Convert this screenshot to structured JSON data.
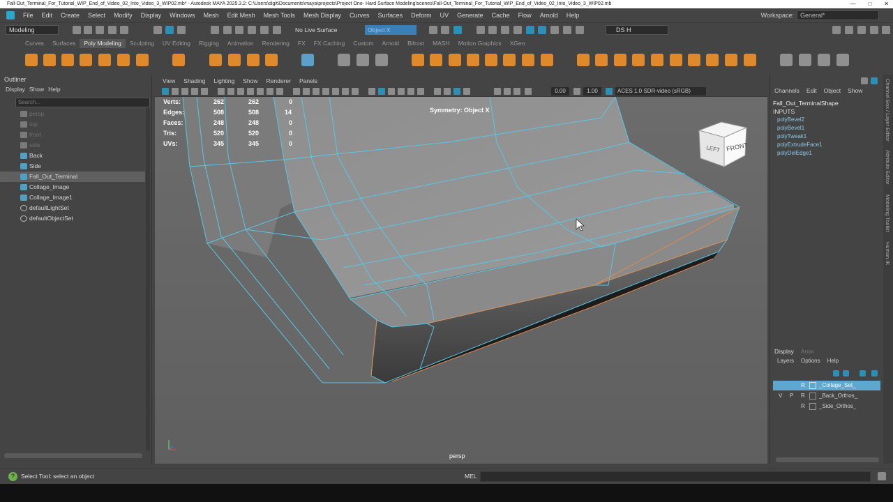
{
  "window": {
    "title": "Fall-Out_Terminal_For_Tutorial_WIP_End_of_Video_02_Into_Video_3_WIP02.mb* - Autodesk MAYA 2025.3.2: C:\\Users\\digit\\Documents\\maya\\projects\\Project One- Hard Surface Modeling\\scenes\\Fall-Out_Terminal_For_Tutorial_WIP_End_of_Video_02_Into_Video_3_WIP02.mb",
    "controls": [
      "—",
      "□",
      "✕"
    ]
  },
  "menubar": {
    "items": [
      "File",
      "Edit",
      "Create",
      "Select",
      "Modify",
      "Display",
      "Windows",
      "Mesh",
      "Edit Mesh",
      "Mesh Tools",
      "Mesh Display",
      "Curves",
      "Surfaces",
      "Deform",
      "UV",
      "Generate",
      "Cache",
      "Flow",
      "Arnold",
      "Help"
    ],
    "workspace_label": "Workspace:",
    "workspace_value": "General*"
  },
  "statusline": {
    "mode": "Modeling",
    "live_surface": "No Live Surface",
    "symmetry": "Object X",
    "user": "DS H"
  },
  "shelf": {
    "tabs": [
      "Curves",
      "Surfaces",
      "Poly Modeling",
      "Sculpting",
      "UV Editing",
      "Rigging",
      "Animation",
      "Rendering",
      "FX",
      "FX Caching",
      "Custom",
      "Arnold",
      "Bifrost",
      "MASH",
      "Motion Graphics",
      "XGen"
    ],
    "active_tab": "Poly Modeling"
  },
  "outliner": {
    "title": "Outliner",
    "menu": [
      "Display",
      "Show",
      "Help"
    ],
    "search_placeholder": "Search...",
    "items": [
      {
        "label": "persp",
        "icon": "camera-icon",
        "dim": true
      },
      {
        "label": "top",
        "icon": "camera-icon",
        "dim": true
      },
      {
        "label": "front",
        "icon": "camera-icon",
        "dim": true
      },
      {
        "label": "side",
        "icon": "camera-icon",
        "dim": true
      },
      {
        "label": "Back",
        "icon": "mesh-icon",
        "dim": false
      },
      {
        "label": "Side",
        "icon": "mesh-icon",
        "dim": false
      },
      {
        "label": "Fall_Out_Terminal",
        "icon": "mesh-icon",
        "dim": false,
        "selected": true
      },
      {
        "label": "Collage_Image",
        "icon": "mesh-icon",
        "dim": false
      },
      {
        "label": "Collage_Image1",
        "icon": "mesh-icon",
        "dim": false
      },
      {
        "label": "defaultLightSet",
        "icon": "set-icon",
        "dim": false
      },
      {
        "label": "defaultObjectSet",
        "icon": "set-icon",
        "dim": false
      }
    ]
  },
  "viewport": {
    "menu": [
      "View",
      "Shading",
      "Lighting",
      "Show",
      "Renderer",
      "Panels"
    ],
    "exposure": "0.00",
    "gamma": "1.00",
    "color_space": "ACES 1.0 SDR-video (sRGB)",
    "hud": [
      {
        "label": "Verts:",
        "a": "262",
        "b": "262",
        "c": "0"
      },
      {
        "label": "Edges:",
        "a": "508",
        "b": "508",
        "c": "14"
      },
      {
        "label": "Faces:",
        "a": "248",
        "b": "248",
        "c": "0"
      },
      {
        "label": "Tris:",
        "a": "520",
        "b": "520",
        "c": "0"
      },
      {
        "label": "UVs:",
        "a": "345",
        "b": "345",
        "c": "0"
      }
    ],
    "symmetry_label": "Symmetry: Object X",
    "camera_label": "persp",
    "viewcube_left": "LEFT",
    "viewcube_front": "FRONT"
  },
  "channelbox": {
    "tabs": [
      "Channels",
      "Edit",
      "Object",
      "Show"
    ],
    "shape_name": "Fall_Out_TerminalShape",
    "inputs_label": "INPUTS",
    "nodes": [
      "polyBevel2",
      "polyBevel1",
      "polyTweak1",
      "polyExtrudeFace1",
      "polyDelEdge1"
    ],
    "side_tabs": [
      "Channel Box / Layer Editor",
      "Attribute Editor",
      "Modeling Toolkit",
      "Human IK"
    ]
  },
  "layers": {
    "tabs": [
      "Display",
      "Anim"
    ],
    "menu": [
      "Layers",
      "Options",
      "Help"
    ],
    "rows": [
      {
        "v": "",
        "p": "",
        "r": "R",
        "name": "_Collage_Set_",
        "selected": true
      },
      {
        "v": "V",
        "p": "P",
        "r": "R",
        "name": "_Back_Orthos_",
        "selected": false
      },
      {
        "v": "",
        "p": "",
        "r": "R",
        "name": "_Side_Orthos_",
        "selected": false
      }
    ]
  },
  "helpline": {
    "text": "Select Tool: select an object",
    "mel_label": "MEL"
  }
}
